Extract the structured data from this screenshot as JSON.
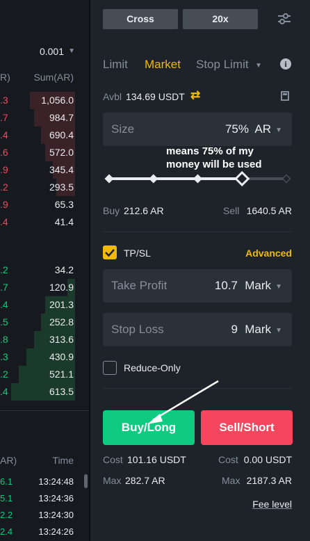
{
  "orderbook": {
    "precision": "0.001",
    "header": {
      "price_fragment": "R)",
      "sum": "Sum(AR)"
    },
    "asks": [
      {
        "price": ".3",
        "sum": "1,056.0",
        "depth": 0.6
      },
      {
        "price": ".7",
        "sum": "984.7",
        "depth": 0.55
      },
      {
        "price": ".4",
        "sum": "690.4",
        "depth": 0.45
      },
      {
        "price": ".6",
        "sum": "572.0",
        "depth": 0.4
      },
      {
        "price": ".9",
        "sum": "345.4",
        "depth": 0.3
      },
      {
        "price": ".2",
        "sum": "293.5",
        "depth": 0.25
      },
      {
        "price": ".9",
        "sum": "65.3",
        "depth": 0
      },
      {
        "price": ".4",
        "sum": "41.4",
        "depth": 0
      }
    ],
    "bids": [
      {
        "price": ".2",
        "sum": "34.2",
        "depth": 0
      },
      {
        "price": ".7",
        "sum": "120.9",
        "depth": 0.1
      },
      {
        "price": ".4",
        "sum": "201.3",
        "depth": 0.4
      },
      {
        "price": ".5",
        "sum": "252.8",
        "depth": 0.45
      },
      {
        "price": ".8",
        "sum": "313.6",
        "depth": 0.55
      },
      {
        "price": ".3",
        "sum": "430.9",
        "depth": 0.65
      },
      {
        "price": ".2",
        "sum": "521.1",
        "depth": 0.75
      },
      {
        "price": ".4",
        "sum": "613.5",
        "depth": 0.85
      }
    ]
  },
  "trades": {
    "header": {
      "amount_fragment": "AR)",
      "time": "Time"
    },
    "rows": [
      {
        "price": "6.1",
        "time": "13:24:48"
      },
      {
        "price": "5.1",
        "time": "13:24:36"
      },
      {
        "price": "2.2",
        "time": "13:24:30"
      },
      {
        "price": "2.4",
        "time": "13:24:26"
      }
    ]
  },
  "order_form": {
    "margin_mode": "Cross",
    "leverage": "20x",
    "tabs": {
      "limit": "Limit",
      "market": "Market",
      "stop_limit": "Stop Limit"
    },
    "active_tab": "Market",
    "avbl_label": "Avbl",
    "avbl_value": "134.69 USDT",
    "size": {
      "label": "Size",
      "value": "75%",
      "unit": "AR"
    },
    "slider": {
      "percent": 75,
      "stops": [
        0,
        25,
        50,
        75,
        100
      ]
    },
    "buy_label": "Buy",
    "buy_value": "212.6 AR",
    "sell_label": "Sell",
    "sell_value": "1640.5 AR",
    "tpsl": {
      "label": "TP/SL",
      "checked": true,
      "advanced": "Advanced"
    },
    "take_profit": {
      "label": "Take Profit",
      "value": "10.7",
      "unit": "Mark"
    },
    "stop_loss": {
      "label": "Stop Loss",
      "value": "9",
      "unit": "Mark"
    },
    "reduce_only": {
      "label": "Reduce-Only",
      "checked": false
    },
    "buy_button": "Buy/Long",
    "sell_button": "Sell/Short",
    "cost_label": "Cost",
    "cost_buy": "101.16 USDT",
    "cost_sell": "0.00 USDT",
    "max_label": "Max",
    "max_buy": "282.7 AR",
    "max_sell": "2187.3 AR",
    "fee_level": "Fee level"
  },
  "annotation": {
    "line1": "means 75% of my",
    "line2": "money will be used"
  },
  "colors": {
    "accent": "#f0b90b",
    "buy": "#0ecb81",
    "sell": "#f6465d"
  }
}
